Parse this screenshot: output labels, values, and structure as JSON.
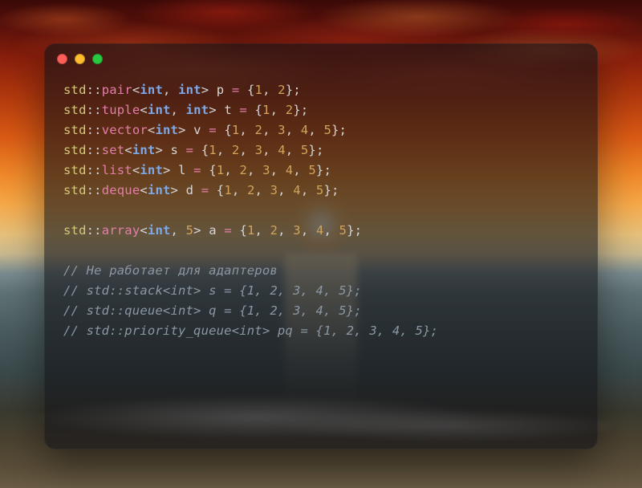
{
  "traffic_lights": {
    "close": "#ff5f57",
    "min": "#febc2e",
    "zoom": "#28c840"
  },
  "code": {
    "lines": [
      {
        "ns": "std",
        "mem": "pair",
        "tpl": "<int, int>",
        "var": "p",
        "init": "{1, 2}"
      },
      {
        "ns": "std",
        "mem": "tuple",
        "tpl": "<int, int>",
        "var": "t",
        "init": "{1, 2}"
      },
      {
        "ns": "std",
        "mem": "vector",
        "tpl": "<int>",
        "var": "v",
        "init": "{1, 2, 3, 4, 5}"
      },
      {
        "ns": "std",
        "mem": "set",
        "tpl": "<int>",
        "var": "s",
        "init": "{1, 2, 3, 4, 5}"
      },
      {
        "ns": "std",
        "mem": "list",
        "tpl": "<int>",
        "var": "l",
        "init": "{1, 2, 3, 4, 5}"
      },
      {
        "ns": "std",
        "mem": "deque",
        "tpl": "<int>",
        "var": "d",
        "init": "{1, 2, 3, 4, 5}"
      }
    ],
    "array_line": {
      "ns": "std",
      "mem": "array",
      "tpl": "<int, 5>",
      "var": "a",
      "init": "{1, 2, 3, 4, 5}"
    },
    "comments": [
      "// Не работает для адаптеров",
      "// std::stack<int> s = {1, 2, 3, 4, 5};",
      "// std::queue<int> q = {1, 2, 3, 4, 5};",
      "// std::priority_queue<int> pq = {1, 2, 3, 4, 5};"
    ]
  }
}
